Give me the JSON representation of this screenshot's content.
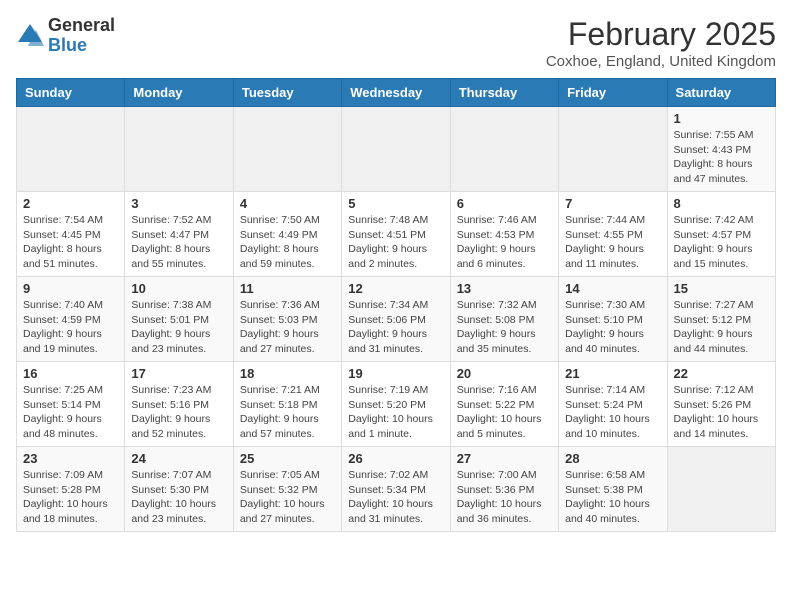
{
  "header": {
    "logo_line1": "General",
    "logo_line2": "Blue",
    "month": "February 2025",
    "location": "Coxhoe, England, United Kingdom"
  },
  "weekdays": [
    "Sunday",
    "Monday",
    "Tuesday",
    "Wednesday",
    "Thursday",
    "Friday",
    "Saturday"
  ],
  "weeks": [
    {
      "days": [
        {
          "num": "",
          "info": ""
        },
        {
          "num": "",
          "info": ""
        },
        {
          "num": "",
          "info": ""
        },
        {
          "num": "",
          "info": ""
        },
        {
          "num": "",
          "info": ""
        },
        {
          "num": "",
          "info": ""
        },
        {
          "num": "1",
          "info": "Sunrise: 7:55 AM\nSunset: 4:43 PM\nDaylight: 8 hours\nand 47 minutes."
        }
      ]
    },
    {
      "days": [
        {
          "num": "2",
          "info": "Sunrise: 7:54 AM\nSunset: 4:45 PM\nDaylight: 8 hours\nand 51 minutes."
        },
        {
          "num": "3",
          "info": "Sunrise: 7:52 AM\nSunset: 4:47 PM\nDaylight: 8 hours\nand 55 minutes."
        },
        {
          "num": "4",
          "info": "Sunrise: 7:50 AM\nSunset: 4:49 PM\nDaylight: 8 hours\nand 59 minutes."
        },
        {
          "num": "5",
          "info": "Sunrise: 7:48 AM\nSunset: 4:51 PM\nDaylight: 9 hours\nand 2 minutes."
        },
        {
          "num": "6",
          "info": "Sunrise: 7:46 AM\nSunset: 4:53 PM\nDaylight: 9 hours\nand 6 minutes."
        },
        {
          "num": "7",
          "info": "Sunrise: 7:44 AM\nSunset: 4:55 PM\nDaylight: 9 hours\nand 11 minutes."
        },
        {
          "num": "8",
          "info": "Sunrise: 7:42 AM\nSunset: 4:57 PM\nDaylight: 9 hours\nand 15 minutes."
        }
      ]
    },
    {
      "days": [
        {
          "num": "9",
          "info": "Sunrise: 7:40 AM\nSunset: 4:59 PM\nDaylight: 9 hours\nand 19 minutes."
        },
        {
          "num": "10",
          "info": "Sunrise: 7:38 AM\nSunset: 5:01 PM\nDaylight: 9 hours\nand 23 minutes."
        },
        {
          "num": "11",
          "info": "Sunrise: 7:36 AM\nSunset: 5:03 PM\nDaylight: 9 hours\nand 27 minutes."
        },
        {
          "num": "12",
          "info": "Sunrise: 7:34 AM\nSunset: 5:06 PM\nDaylight: 9 hours\nand 31 minutes."
        },
        {
          "num": "13",
          "info": "Sunrise: 7:32 AM\nSunset: 5:08 PM\nDaylight: 9 hours\nand 35 minutes."
        },
        {
          "num": "14",
          "info": "Sunrise: 7:30 AM\nSunset: 5:10 PM\nDaylight: 9 hours\nand 40 minutes."
        },
        {
          "num": "15",
          "info": "Sunrise: 7:27 AM\nSunset: 5:12 PM\nDaylight: 9 hours\nand 44 minutes."
        }
      ]
    },
    {
      "days": [
        {
          "num": "16",
          "info": "Sunrise: 7:25 AM\nSunset: 5:14 PM\nDaylight: 9 hours\nand 48 minutes."
        },
        {
          "num": "17",
          "info": "Sunrise: 7:23 AM\nSunset: 5:16 PM\nDaylight: 9 hours\nand 52 minutes."
        },
        {
          "num": "18",
          "info": "Sunrise: 7:21 AM\nSunset: 5:18 PM\nDaylight: 9 hours\nand 57 minutes."
        },
        {
          "num": "19",
          "info": "Sunrise: 7:19 AM\nSunset: 5:20 PM\nDaylight: 10 hours\nand 1 minute."
        },
        {
          "num": "20",
          "info": "Sunrise: 7:16 AM\nSunset: 5:22 PM\nDaylight: 10 hours\nand 5 minutes."
        },
        {
          "num": "21",
          "info": "Sunrise: 7:14 AM\nSunset: 5:24 PM\nDaylight: 10 hours\nand 10 minutes."
        },
        {
          "num": "22",
          "info": "Sunrise: 7:12 AM\nSunset: 5:26 PM\nDaylight: 10 hours\nand 14 minutes."
        }
      ]
    },
    {
      "days": [
        {
          "num": "23",
          "info": "Sunrise: 7:09 AM\nSunset: 5:28 PM\nDaylight: 10 hours\nand 18 minutes."
        },
        {
          "num": "24",
          "info": "Sunrise: 7:07 AM\nSunset: 5:30 PM\nDaylight: 10 hours\nand 23 minutes."
        },
        {
          "num": "25",
          "info": "Sunrise: 7:05 AM\nSunset: 5:32 PM\nDaylight: 10 hours\nand 27 minutes."
        },
        {
          "num": "26",
          "info": "Sunrise: 7:02 AM\nSunset: 5:34 PM\nDaylight: 10 hours\nand 31 minutes."
        },
        {
          "num": "27",
          "info": "Sunrise: 7:00 AM\nSunset: 5:36 PM\nDaylight: 10 hours\nand 36 minutes."
        },
        {
          "num": "28",
          "info": "Sunrise: 6:58 AM\nSunset: 5:38 PM\nDaylight: 10 hours\nand 40 minutes."
        },
        {
          "num": "",
          "info": ""
        }
      ]
    }
  ]
}
